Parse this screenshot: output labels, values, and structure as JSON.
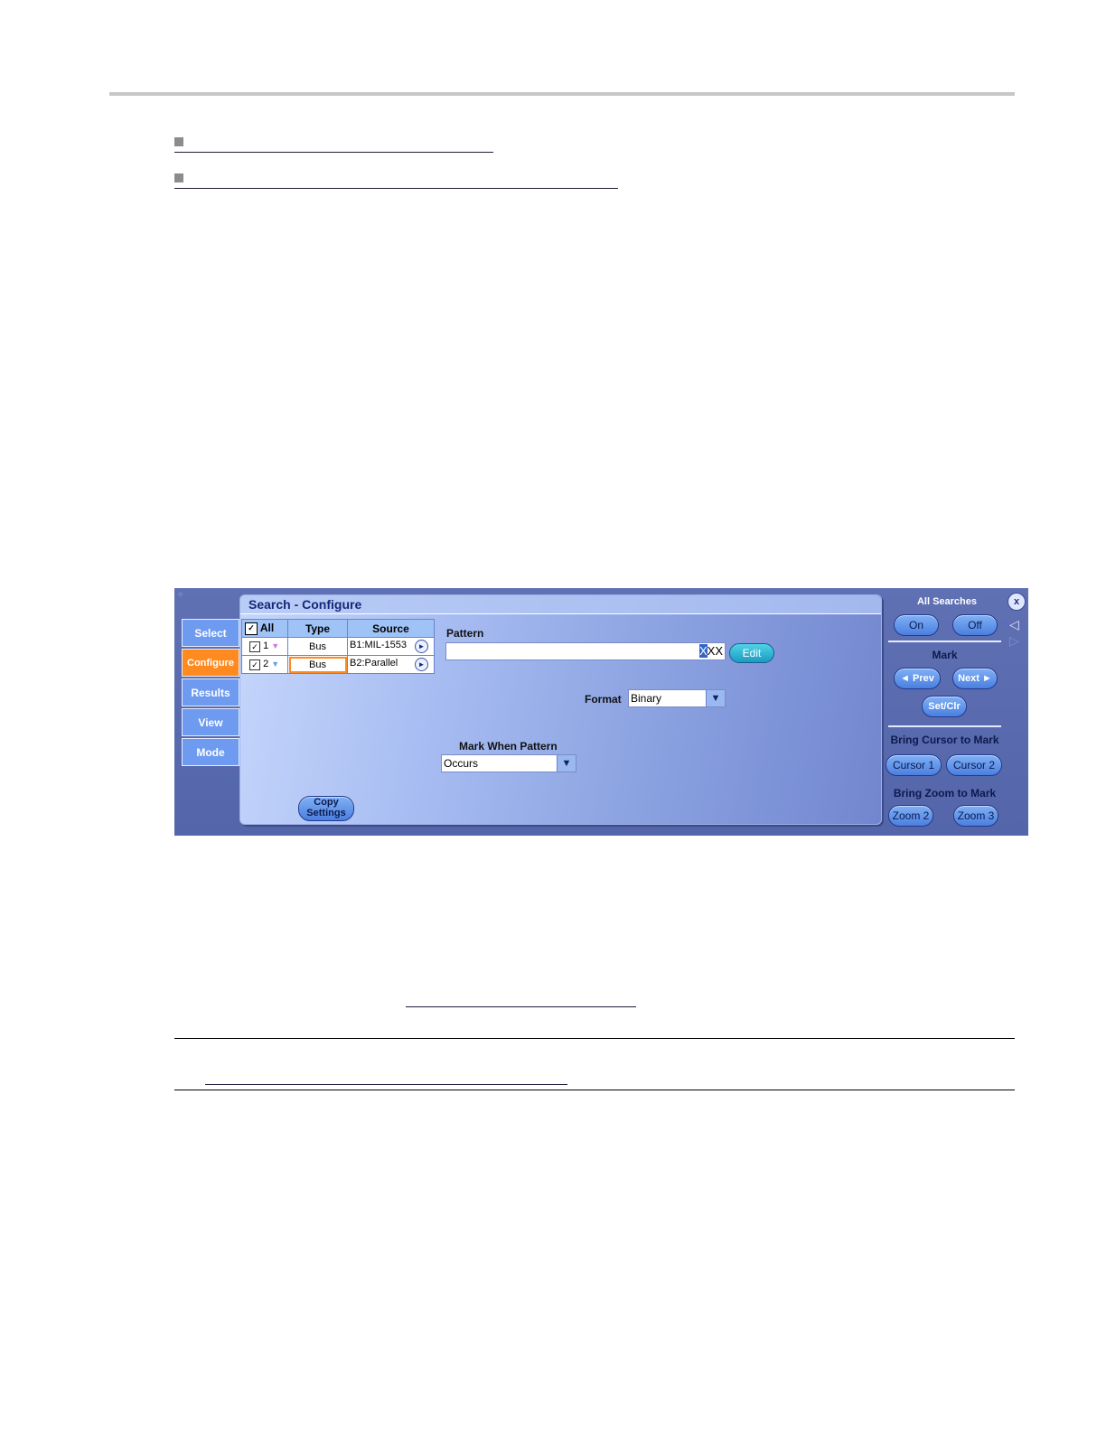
{
  "panel": {
    "title": "Search - Configure",
    "tabs": [
      {
        "label": "Select",
        "active": false
      },
      {
        "label": "Configure",
        "active": true
      },
      {
        "label": "Results",
        "active": false
      },
      {
        "label": "View",
        "active": false
      },
      {
        "label": "Mode",
        "active": false
      }
    ],
    "table": {
      "headers": {
        "all": "All",
        "type": "Type",
        "source": "Source"
      },
      "rows": [
        {
          "num": "1",
          "type": "Bus",
          "source": "B1:MIL-1553",
          "color": "#c77bd6"
        },
        {
          "num": "2",
          "type": "Bus",
          "source": "B2:Parallel",
          "color": "#5aa7e8"
        }
      ]
    },
    "pattern": {
      "label": "Pattern",
      "value_selected": "X",
      "value_rest": "XX",
      "edit_label": "Edit"
    },
    "format": {
      "label": "Format",
      "value": "Binary"
    },
    "mark_when": {
      "label": "Mark When Pattern",
      "value": "Occurs"
    },
    "copy_settings": {
      "line1": "Copy",
      "line2": "Settings"
    },
    "side": {
      "all_searches": "All Searches",
      "on": "On",
      "off": "Off",
      "mark": "Mark",
      "prev": "◄ Prev",
      "next": "Next ►",
      "setclr": "Set/Clr",
      "bring_cursor": "Bring Cursor to Mark",
      "cursor1": "Cursor 1",
      "cursor2": "Cursor 2",
      "bring_zoom": "Bring Zoom to Mark",
      "zoom2": "Zoom 2",
      "zoom3": "Zoom 3",
      "close": "x"
    },
    "colors": {
      "accent": "#ff8a1f",
      "tab": "#6e9bf0",
      "panel_bg": "#5a6bb0"
    }
  }
}
